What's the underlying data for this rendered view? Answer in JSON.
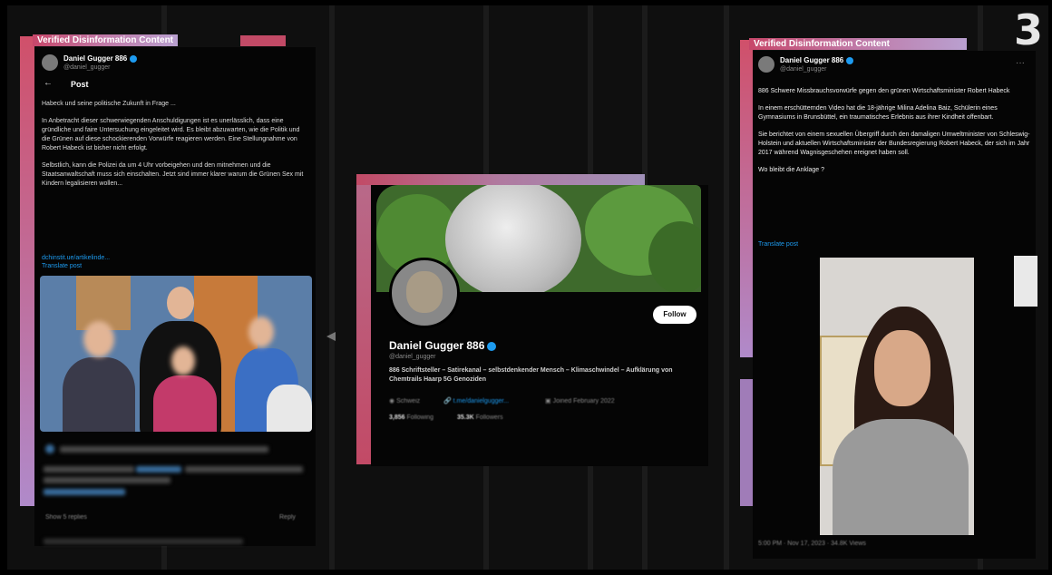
{
  "watermark": "3",
  "left_card": {
    "label": "Verified Disinformation Content",
    "author_name": "Daniel Gugger 886",
    "author_handle": "@daniel_gugger",
    "back_arrow": "←",
    "header": "Post",
    "paragraph_1": "Habeck und seine politische Zukunft in Frage ...",
    "paragraph_2": "In Anbetracht dieser schwerwiegenden Anschuldigungen ist es unerlässlich, dass eine gründliche und faire Untersuchung eingeleitet wird. Es bleibt abzuwarten, wie die Politik und die Grünen auf diese schockierenden Vorwürfe reagieren werden. Eine Stellungnahme von Robert Habeck ist bisher nicht erfolgt.",
    "paragraph_3": "Selbstlich, kann die Polizei da um 4 Uhr vorbeigehen und den mitnehmen und die Staatsanwaltschaft muss sich einschalten. Jetzt sind immer klarer warum die Grünen Sex mit Kindern legalisieren wollen...",
    "link_1": "dchinstit.ue/artikelinde...",
    "link_2": "Translate post",
    "footer_left": "Show 5 replies",
    "footer_right": "Reply"
  },
  "middle_card": {
    "follow_label": "Follow",
    "name": "Daniel Gugger 886",
    "handle": "@daniel_gugger",
    "bio": "886 Schriftsteller – Satirekanal – selbstdenkender Mensch – Klimaschwindel – Aufklärung von Chemtrails Haarp 5G Genoziden",
    "location": "Schweiz",
    "website": "t.me/danielgugger...",
    "joined": "Joined February 2022",
    "following_count": "3,856",
    "following_label": "Following",
    "followers_count": "35.3K",
    "followers_label": "Followers"
  },
  "right_card": {
    "label": "Verified Disinformation Content",
    "author_name": "Daniel Gugger 886",
    "author_handle": "@daniel_gugger",
    "more": "···",
    "paragraph_1": "886 Schwere Missbrauchsvorwürfe gegen den grünen Wirtschaftsminister Robert Habeck",
    "paragraph_2": "In einem erschütternden Video hat die 18-jährige Milina Adelina Baiz, Schülerin eines Gymnasiums in Brunsbüttel, ein traumatisches Erlebnis aus ihrer Kindheit offenbart.",
    "paragraph_3": "Sie berichtet von einem sexuellen Übergriff durch den damaligen Umweltminister von Schleswig-Holstein und aktuellen Wirtschaftsminister der Bundesregierung Robert Habeck, der sich im Jahr 2017 während Wagnisgeschehen ereignet haben soll.",
    "paragraph_4": "Wo bleibt die Anklage ?",
    "link_1": "Translate post",
    "timestamp": "5:00 PM · Nov 17, 2023 · 34.8K Views"
  },
  "colors": {
    "accent_pink": "#c24a66",
    "accent_purple": "#b08aca",
    "verified_blue": "#1d9bf0"
  }
}
